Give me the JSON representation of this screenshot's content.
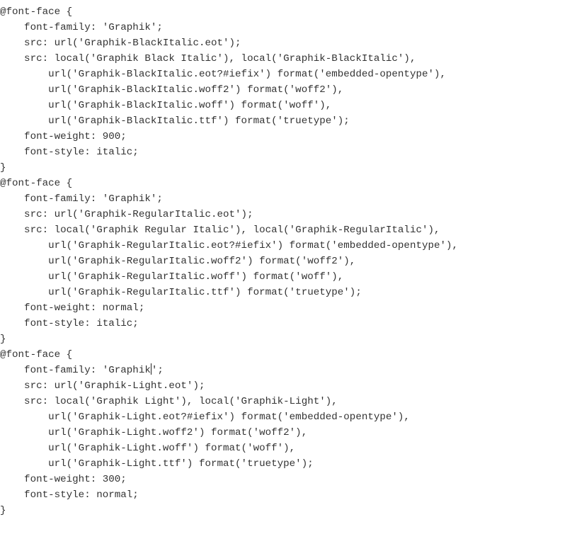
{
  "code": {
    "lines": [
      "@font-face {",
      "    font-family: 'Graphik';",
      "    src: url('Graphik-BlackItalic.eot');",
      "    src: local('Graphik Black Italic'), local('Graphik-BlackItalic'),",
      "        url('Graphik-BlackItalic.eot?#iefix') format('embedded-opentype'),",
      "        url('Graphik-BlackItalic.woff2') format('woff2'),",
      "        url('Graphik-BlackItalic.woff') format('woff'),",
      "        url('Graphik-BlackItalic.ttf') format('truetype');",
      "    font-weight: 900;",
      "    font-style: italic;",
      "}",
      "",
      "@font-face {",
      "    font-family: 'Graphik';",
      "    src: url('Graphik-RegularItalic.eot');",
      "    src: local('Graphik Regular Italic'), local('Graphik-RegularItalic'),",
      "        url('Graphik-RegularItalic.eot?#iefix') format('embedded-opentype'),",
      "        url('Graphik-RegularItalic.woff2') format('woff2'),",
      "        url('Graphik-RegularItalic.woff') format('woff'),",
      "        url('Graphik-RegularItalic.ttf') format('truetype');",
      "    font-weight: normal;",
      "    font-style: italic;",
      "}",
      "",
      "@font-face {",
      "    font-family: 'Graphik|';",
      "    src: url('Graphik-Light.eot');",
      "    src: local('Graphik Light'), local('Graphik-Light'),",
      "        url('Graphik-Light.eot?#iefix') format('embedded-opentype'),",
      "        url('Graphik-Light.woff2') format('woff2'),",
      "        url('Graphik-Light.woff') format('woff'),",
      "        url('Graphik-Light.ttf') format('truetype');",
      "    font-weight: 300;",
      "    font-style: normal;",
      "}"
    ],
    "caret_line_index": 25,
    "caret_marker": "|"
  }
}
